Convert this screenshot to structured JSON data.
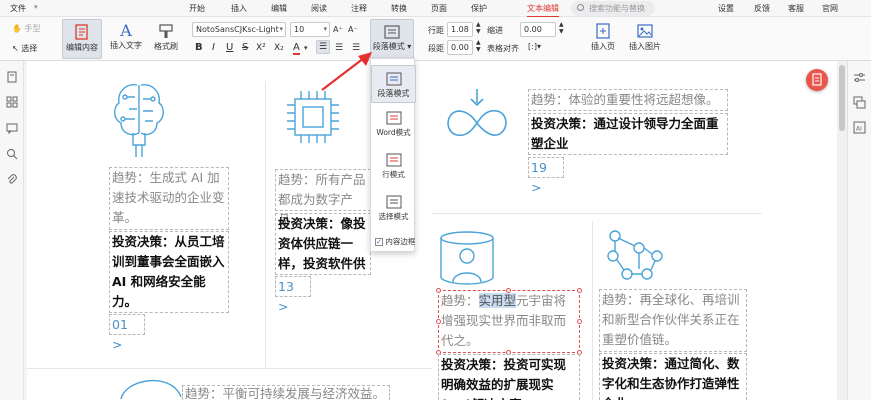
{
  "menubar": {
    "items": [
      "文件",
      "开始",
      "插入",
      "编辑",
      "阅读",
      "注释",
      "转换",
      "页面",
      "保护",
      "文本编辑"
    ],
    "search_placeholder": "搜索功能与替换",
    "right": [
      "设置",
      "反馈",
      "客服",
      "官网"
    ]
  },
  "toolbar": {
    "hand": "手型",
    "select": "选择",
    "edit_content": "编辑内容",
    "insert_text": "插入文字",
    "format_brush": "格式刷",
    "font_name": "NotoSansCJKsc-Light",
    "font_size": "10",
    "para_mode": "段落模式",
    "line_spacing_label": "行距",
    "line_spacing_value": "1.08",
    "para_spacing_label": "段距",
    "para_spacing_value": "0.00",
    "indent_label": "缩进",
    "indent_value": "0.00",
    "table_align_label": "表格对齐",
    "insert_page": "插入页",
    "insert_image": "插入图片"
  },
  "dropdown": {
    "items": [
      "段落模式",
      "Word模式",
      "行模式",
      "选择模式"
    ],
    "content_border": "内容边框"
  },
  "content": {
    "col1": {
      "trend": "趋势：生成式 AI 加速技术驱动的企业变革。",
      "decision": "投资决策：从员工培训到董事会全面嵌入 AI 和网络安全能力。",
      "num": "01 >"
    },
    "col2": {
      "trend": "趋势：所有产品都成为数字产品。",
      "decision": "投资决策：像投资体供应链一样，投资软件供应链。",
      "num": "13 >"
    },
    "col3": {
      "trend": "趋势：体验的重要性将远超想像。",
      "decision": "投资决策：通过设计领导力全面重塑企业",
      "num": "19 >"
    },
    "col4": {
      "trend_pre": "趋势：",
      "trend_hl": "实用型",
      "trend_post": "元宇宙将增强现实世界而非取而代之。",
      "decision": "投资决策：投资可实现明确效益的扩展现实(XR)解决方案"
    },
    "col5": {
      "trend": "趋势：再全球化、再培训和新型合作伙伴关系正在重塑价值链。",
      "decision": "投资决策：通过简化、数字化和生态协作打造弹性企业"
    },
    "col6": {
      "trend": "趋势：平衡可持续发展与经济效益。"
    }
  }
}
